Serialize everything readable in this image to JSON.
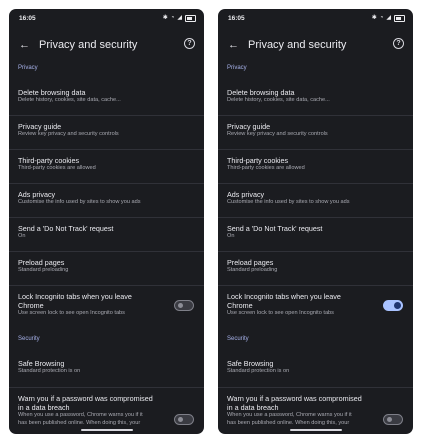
{
  "screens": [
    {
      "status_time": "16:05",
      "title": "Privacy and security",
      "section_privacy": "Privacy",
      "items": [
        {
          "title": "Delete browsing data",
          "subtitle": "Delete history, cookies, site data, cache..."
        },
        {
          "title": "Privacy guide",
          "subtitle": "Review key privacy and security controls"
        },
        {
          "title": "Third-party cookies",
          "subtitle": "Third-party cookies are allowed"
        },
        {
          "title": "Ads privacy",
          "subtitle": "Customise the info used by sites to show you ads"
        },
        {
          "title": "Send a 'Do Not Track' request",
          "subtitle": "On"
        },
        {
          "title": "Preload pages",
          "subtitle": "Standard preloading"
        }
      ],
      "lock_incognito": {
        "title_line1": "Lock Incognito tabs when you leave",
        "title_line2": "Chrome",
        "subtitle": "Use screen lock to see open Incognito tabs",
        "toggle_state": "off"
      },
      "section_security": "Security",
      "safe_browsing": {
        "title": "Safe Browsing",
        "subtitle": "Standard protection is on"
      },
      "password_warn": {
        "title_line1": "Warn you if a password was compromised",
        "title_line2": "in a data breach",
        "subtitle_line1": "When you use a password, Chrome warns you if it",
        "subtitle_line2": "has been published online. When doing this, your",
        "toggle_state": "off"
      }
    },
    {
      "status_time": "16:05",
      "title": "Privacy and security",
      "section_privacy": "Privacy",
      "items": [
        {
          "title": "Delete browsing data",
          "subtitle": "Delete history, cookies, site data, cache..."
        },
        {
          "title": "Privacy guide",
          "subtitle": "Review key privacy and security controls"
        },
        {
          "title": "Third-party cookies",
          "subtitle": "Third-party cookies are allowed"
        },
        {
          "title": "Ads privacy",
          "subtitle": "Customise the info used by sites to show you ads"
        },
        {
          "title": "Send a 'Do Not Track' request",
          "subtitle": "On"
        },
        {
          "title": "Preload pages",
          "subtitle": "Standard preloading"
        }
      ],
      "lock_incognito": {
        "title_line1": "Lock Incognito tabs when you leave",
        "title_line2": "Chrome",
        "subtitle": "Use screen lock to see open Incognito tabs",
        "toggle_state": "on"
      },
      "section_security": "Security",
      "safe_browsing": {
        "title": "Safe Browsing",
        "subtitle": "Standard protection is on"
      },
      "password_warn": {
        "title_line1": "Warn you if a password was compromised",
        "title_line2": "in a data breach",
        "subtitle_line1": "When you use a password, Chrome warns you if it",
        "subtitle_line2": "has been published online. When doing this, your",
        "toggle_state": "off"
      }
    }
  ],
  "colors": {
    "background": "#1b1c20",
    "section_header": "#a7b2ea",
    "toggle_on": "#a9c2ff"
  }
}
